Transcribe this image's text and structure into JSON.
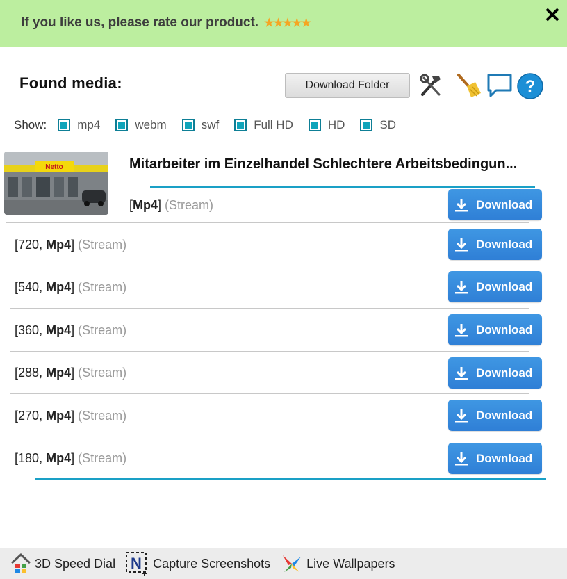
{
  "banner": {
    "text": "If you like us, please rate our product.",
    "stars": "★★★★★",
    "close_icon": "close-icon"
  },
  "header": {
    "title": "Found media:",
    "download_folder_label": "Download Folder",
    "icons": [
      "tools-icon",
      "broom-icon",
      "chat-icon",
      "help-icon"
    ],
    "help_glyph": "?"
  },
  "filters": {
    "label": "Show:",
    "items": [
      {
        "label": "mp4",
        "checked": true
      },
      {
        "label": "webm",
        "checked": true
      },
      {
        "label": "swf",
        "checked": true
      },
      {
        "label": "Full HD",
        "checked": true
      },
      {
        "label": "HD",
        "checked": true
      },
      {
        "label": "SD",
        "checked": true
      }
    ]
  },
  "video": {
    "title": "Mitarbeiter im Einzelhandel Schlechtere Arbeitsbedingun...",
    "thumbnail_sign": "Netto",
    "rows": [
      {
        "quality": "",
        "format": "Mp4",
        "source": "(Stream)",
        "button": "Download"
      },
      {
        "quality": "720",
        "format": "Mp4",
        "source": "(Stream)",
        "button": "Download"
      },
      {
        "quality": "540",
        "format": "Mp4",
        "source": "(Stream)",
        "button": "Download"
      },
      {
        "quality": "360",
        "format": "Mp4",
        "source": "(Stream)",
        "button": "Download"
      },
      {
        "quality": "288",
        "format": "Mp4",
        "source": "(Stream)",
        "button": "Download"
      },
      {
        "quality": "270",
        "format": "Mp4",
        "source": "(Stream)",
        "button": "Download"
      },
      {
        "quality": "180",
        "format": "Mp4",
        "source": "(Stream)",
        "button": "Download"
      }
    ]
  },
  "footer": {
    "items": [
      {
        "label": "3D Speed Dial",
        "icon": "speed-dial-icon"
      },
      {
        "label": "Capture Screenshots",
        "icon": "capture-screenshot-icon"
      },
      {
        "label": "Live Wallpapers",
        "icon": "live-wallpapers-icon"
      }
    ]
  },
  "colors": {
    "banner": "#bcee9f",
    "accent": "#1aa0c6",
    "download_button": "#3a8fdf",
    "checkbox": "#0fa4ba"
  }
}
